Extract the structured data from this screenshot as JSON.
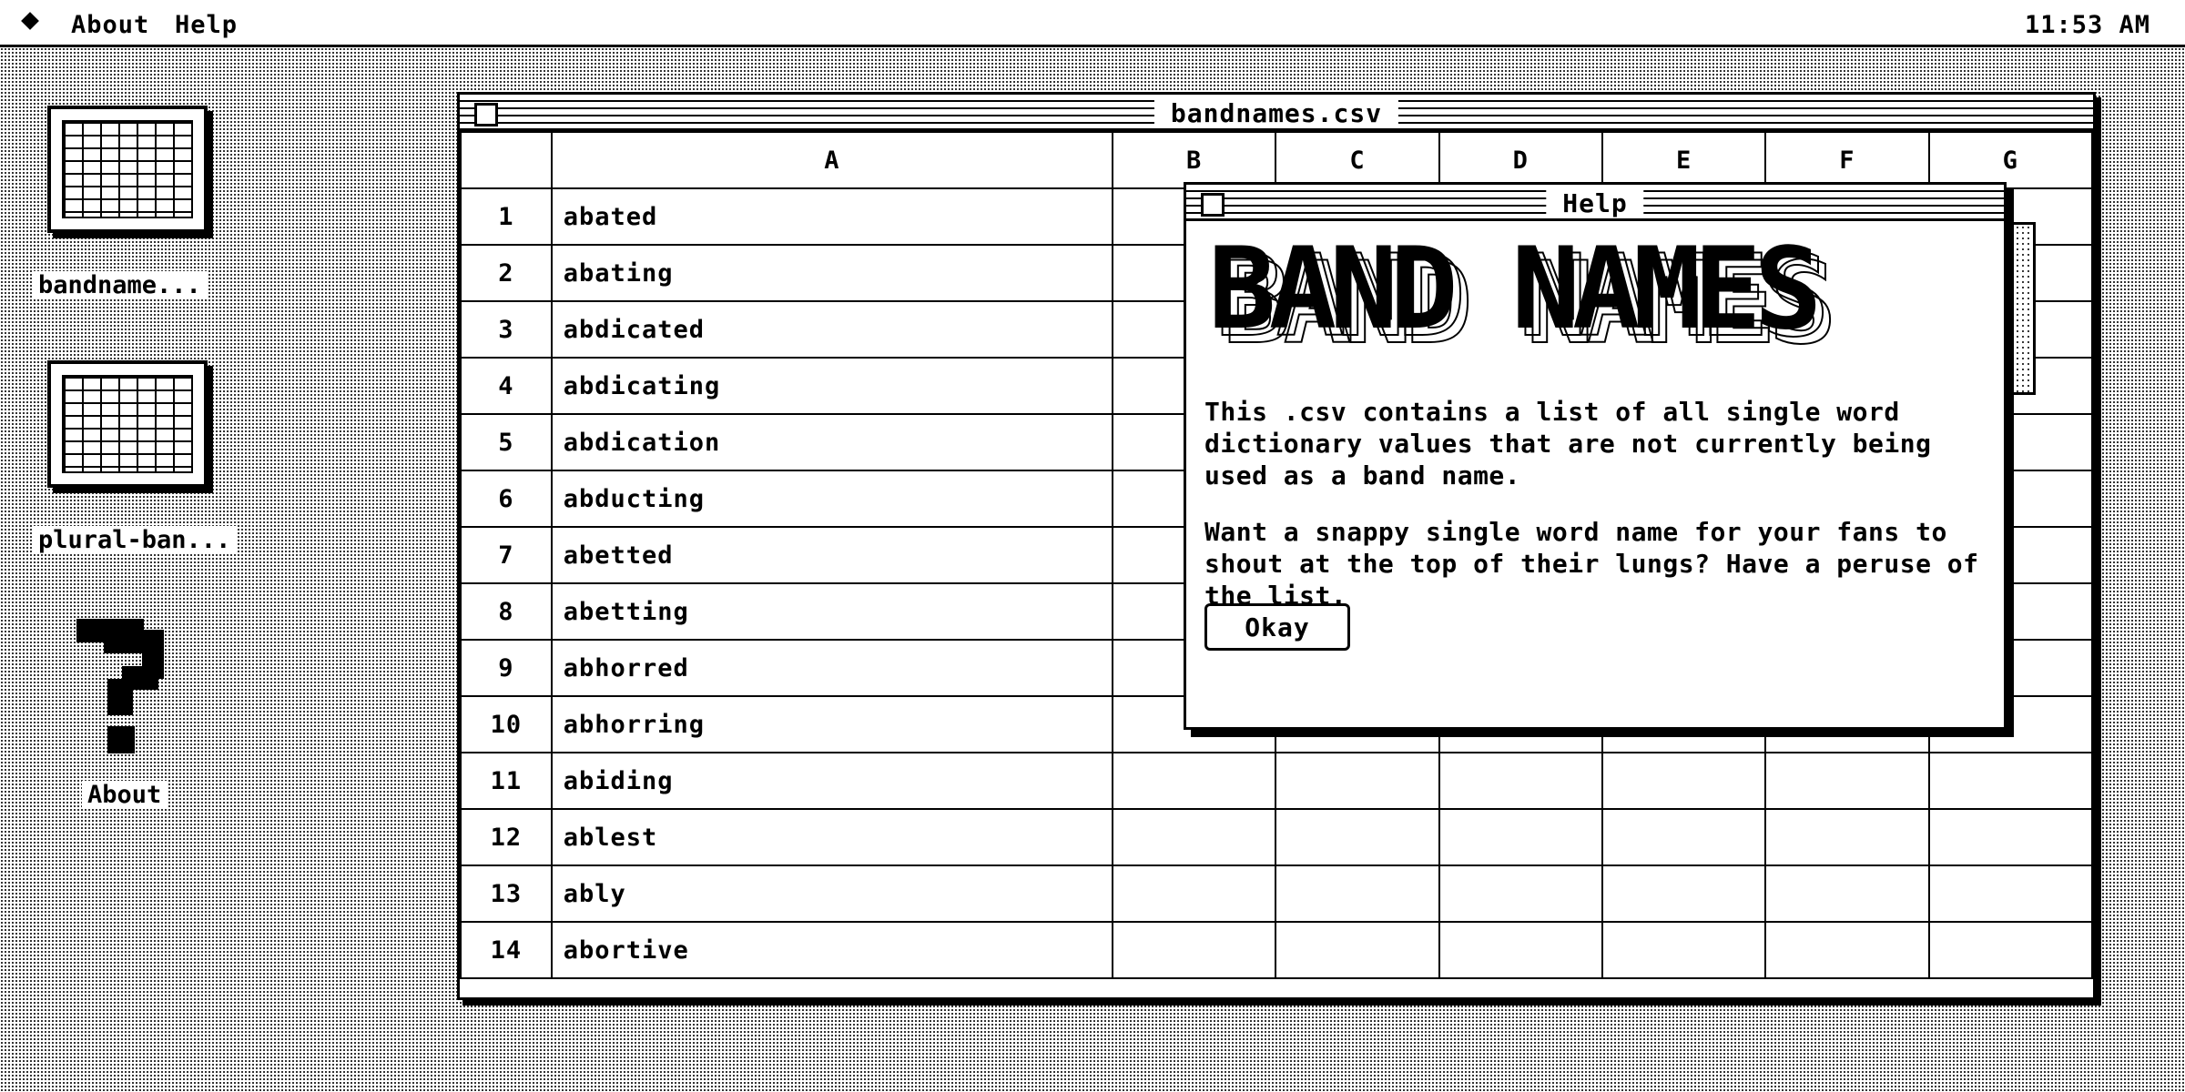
{
  "menubar": {
    "apple_icon": "apple-diamond-icon",
    "items": [
      "About",
      "Help"
    ],
    "clock": "11:53 AM"
  },
  "desktop": {
    "icons": [
      {
        "label": "bandname...",
        "icon": "spreadsheet-icon"
      },
      {
        "label": "plural-ban...",
        "icon": "spreadsheet-icon"
      },
      {
        "label": "About",
        "icon": "question-mark-icon"
      }
    ]
  },
  "window": {
    "title": "bandnames.csv",
    "columns": [
      "A",
      "B",
      "C",
      "D",
      "E",
      "F",
      "G"
    ],
    "rows": [
      {
        "num": "1",
        "a": "abated"
      },
      {
        "num": "2",
        "a": "abating"
      },
      {
        "num": "3",
        "a": "abdicated"
      },
      {
        "num": "4",
        "a": "abdicating"
      },
      {
        "num": "5",
        "a": "abdication"
      },
      {
        "num": "6",
        "a": "abducting"
      },
      {
        "num": "7",
        "a": "abetted"
      },
      {
        "num": "8",
        "a": "abetting"
      },
      {
        "num": "9",
        "a": "abhorred"
      },
      {
        "num": "10",
        "a": "abhorring"
      },
      {
        "num": "11",
        "a": "abiding"
      },
      {
        "num": "12",
        "a": "ablest"
      },
      {
        "num": "13",
        "a": "ably"
      },
      {
        "num": "14",
        "a": "abortive"
      }
    ]
  },
  "dialog": {
    "title": "Help",
    "logo_text": "BAND NAMES",
    "paragraph1": "This .csv contains a list of all single word dictionary values that are not currently being used as a band name.",
    "paragraph2": "Want a snappy single word name for your fans to shout at the top of their lungs? Have a peruse of the list.",
    "ok_label": "Okay"
  }
}
